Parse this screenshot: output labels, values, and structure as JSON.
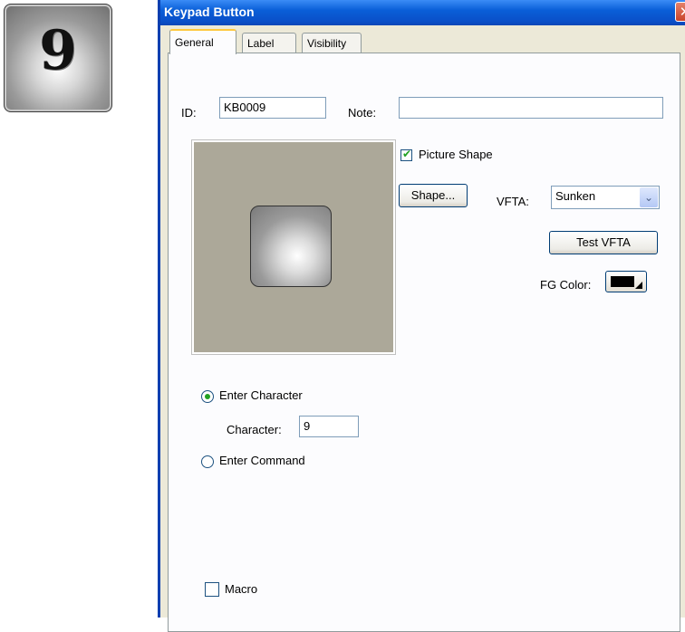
{
  "preview": {
    "digit": "9"
  },
  "dialog": {
    "title": "Keypad Button",
    "close_glyph": "✕",
    "tabs": [
      {
        "label": "General",
        "active": true
      },
      {
        "label": "Label",
        "active": false
      },
      {
        "label": "Visibility",
        "active": false
      }
    ],
    "id_label": "ID:",
    "id_value": "KB0009",
    "note_label": "Note:",
    "note_value": "",
    "picture_shape_label": "Picture Shape",
    "picture_shape_checked": true,
    "shape_button": "Shape...",
    "vfta_label": "VFTA:",
    "vfta_value": "Sunken",
    "test_vfta_button": "Test VFTA",
    "fg_color_label": "FG Color:",
    "fg_color": "#000000",
    "enter_character_label": "Enter Character",
    "enter_character_selected": true,
    "character_label": "Character:",
    "character_value": "9",
    "enter_command_label": "Enter Command",
    "macro_label": "Macro",
    "macro_checked": false
  },
  "icons": {
    "check": "✔",
    "dropdown": "⌄"
  }
}
